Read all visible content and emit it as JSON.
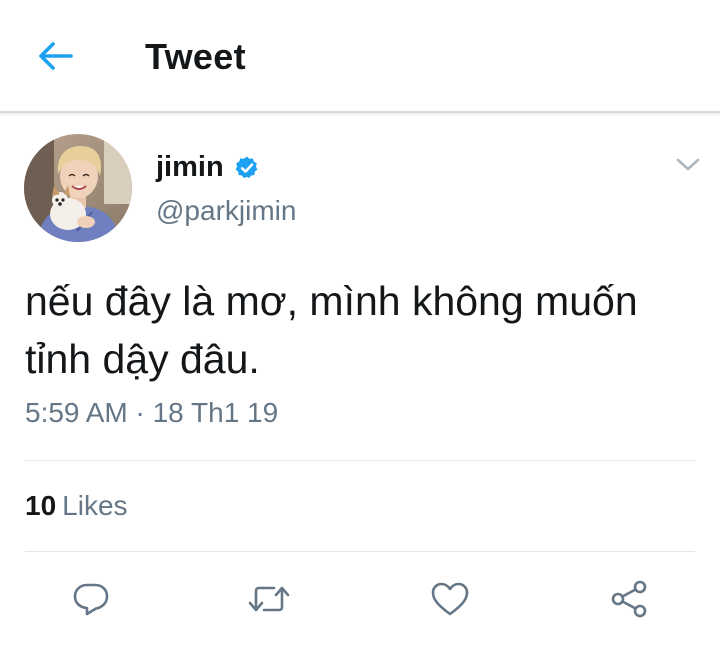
{
  "header": {
    "title": "Tweet"
  },
  "tweet": {
    "author": {
      "display_name": "jimin",
      "handle": "@parkjimin",
      "verified": true
    },
    "text_line1": "nếu đây là mơ, mình không muốn",
    "text_line2": "tỉnh dậy đâu.",
    "timestamp": "5:59 AM · 18 Th1 19"
  },
  "stats": {
    "likes_count": "10",
    "likes_label": "Likes"
  },
  "actions": [
    {
      "icon": "reply-icon"
    },
    {
      "icon": "retweet-icon"
    },
    {
      "icon": "like-icon"
    },
    {
      "icon": "share-icon"
    }
  ],
  "colors": {
    "accent": "#1da1f2",
    "text_primary": "#14171a",
    "text_secondary": "#657786",
    "divider": "#e1e8ed"
  }
}
